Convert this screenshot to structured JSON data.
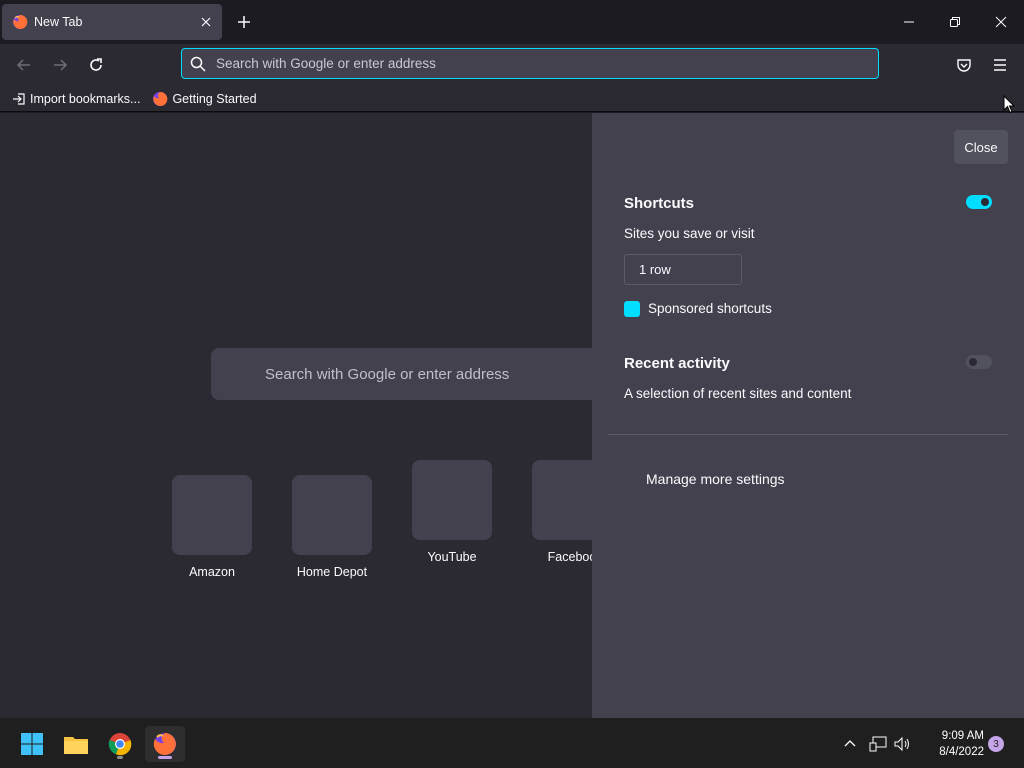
{
  "browser": {
    "tab": {
      "title": "New Tab"
    },
    "urlbar": {
      "placeholder": "Search with Google or enter address"
    },
    "bookmarks": [
      {
        "label": "Import bookmarks..."
      },
      {
        "label": "Getting Started"
      }
    ]
  },
  "newtab": {
    "search_placeholder": "Search with Google or enter address",
    "tiles": [
      {
        "label": "Amazon"
      },
      {
        "label": "Home Depot"
      },
      {
        "label": "YouTube"
      },
      {
        "label": "Faceboo"
      }
    ]
  },
  "customize_panel": {
    "close_label": "Close",
    "shortcuts": {
      "title": "Shortcuts",
      "enabled": true,
      "subtitle": "Sites you save or visit",
      "rows_value": "1 row",
      "sponsored_label": "Sponsored shortcuts",
      "sponsored_checked": true
    },
    "recent_activity": {
      "title": "Recent activity",
      "enabled": false,
      "subtitle": "A selection of recent sites and content"
    },
    "manage_label": "Manage more settings"
  },
  "taskbar": {
    "time": "9:09 AM",
    "date": "8/4/2022",
    "notification_count": "3",
    "apps": [
      "windows-start-icon",
      "file-explorer-icon",
      "chrome-icon",
      "firefox-icon"
    ]
  },
  "colors": {
    "accent": "#00ddff",
    "panel": "#42414d",
    "background": "#2b2a33"
  }
}
